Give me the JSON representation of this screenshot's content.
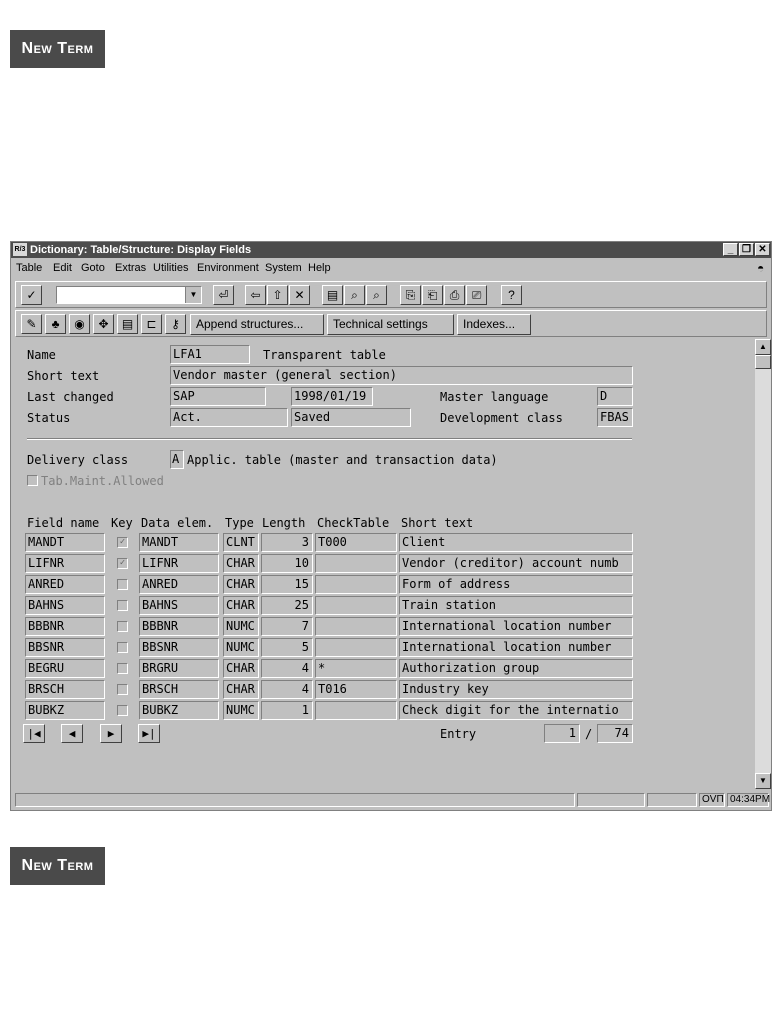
{
  "new_term_label": "New Term",
  "window": {
    "title": "Dictionary: Table/Structure: Display Fields",
    "sys_icon": "R/3",
    "controls": {
      "minimize": "_",
      "maximize": "❐",
      "close": "✕"
    }
  },
  "menu": [
    "Table",
    "Edit",
    "Goto",
    "Extras",
    "Utilities",
    "Environment",
    "System",
    "Help"
  ],
  "toolbar": {
    "command_value": "",
    "icons": {
      "check": "✓",
      "dropdown": "▼",
      "enter": "⏎",
      "back": "⇦",
      "exit": "⇧",
      "cancel": "✕",
      "print": "▤",
      "find": "⌕",
      "find_next": "⌕",
      "first_page": "⎘",
      "prev_page": "⎗",
      "next_page": "⎙",
      "last_page": "⎚",
      "help": "?"
    }
  },
  "app_toolbar": {
    "icons": [
      "✎",
      "♣",
      "◉",
      "✥",
      "▤",
      "⊏",
      "⚷"
    ],
    "append_structures": "Append structures...",
    "technical_settings": "Technical settings",
    "indexes": "Indexes..."
  },
  "header": {
    "name_label": "Name",
    "name_value": "LFA1",
    "table_type": "Transparent table",
    "short_text_label": "Short text",
    "short_text_value": "Vendor master (general section)",
    "last_changed_label": "Last changed",
    "last_changed_user": "SAP",
    "last_changed_date": "1998/01/19",
    "master_language_label": "Master language",
    "master_language_value": "D",
    "status_label": "Status",
    "status_value": "Act.",
    "status_saved": "Saved",
    "dev_class_label": "Development class",
    "dev_class_value": "FBAS"
  },
  "delivery": {
    "label": "Delivery class",
    "value": "A",
    "description": "Applic. table (master and transaction data)",
    "tab_maint_label": "Tab.Maint.Allowed"
  },
  "fields_table": {
    "headers": [
      "Field name",
      "Key",
      "Data elem.",
      "Type",
      "Length",
      "CheckTable",
      "Short text"
    ],
    "rows": [
      {
        "field": "MANDT",
        "key": true,
        "elem": "MANDT",
        "type": "CLNT",
        "length": "3",
        "check": "T000",
        "text": "Client"
      },
      {
        "field": "LIFNR",
        "key": true,
        "elem": "LIFNR",
        "type": "CHAR",
        "length": "10",
        "check": "",
        "text": "Vendor (creditor) account numb"
      },
      {
        "field": "ANRED",
        "key": false,
        "elem": "ANRED",
        "type": "CHAR",
        "length": "15",
        "check": "",
        "text": "Form of address"
      },
      {
        "field": "BAHNS",
        "key": false,
        "elem": "BAHNS",
        "type": "CHAR",
        "length": "25",
        "check": "",
        "text": "Train station"
      },
      {
        "field": "BBBNR",
        "key": false,
        "elem": "BBBNR",
        "type": "NUMC",
        "length": "7",
        "check": "",
        "text": "International location number"
      },
      {
        "field": "BBSNR",
        "key": false,
        "elem": "BBSNR",
        "type": "NUMC",
        "length": "5",
        "check": "",
        "text": "International location number"
      },
      {
        "field": "BEGRU",
        "key": false,
        "elem": "BRGRU",
        "type": "CHAR",
        "length": "4",
        "check": "*",
        "text": "Authorization group"
      },
      {
        "field": "BRSCH",
        "key": false,
        "elem": "BRSCH",
        "type": "CHAR",
        "length": "4",
        "check": "T016",
        "text": "Industry key"
      },
      {
        "field": "BUBKZ",
        "key": false,
        "elem": "BUBKZ",
        "type": "NUMC",
        "length": "1",
        "check": "",
        "text": "Check digit for the internatio"
      }
    ]
  },
  "navigation": {
    "first": "|◀",
    "prev": "◀",
    "next": "▶",
    "last": "▶|",
    "entry_label": "Entry",
    "entry_current": "1",
    "entry_sep": "/",
    "entry_total": "74"
  },
  "statusbar": {
    "system": "OVП",
    "time": "04:34PM"
  }
}
